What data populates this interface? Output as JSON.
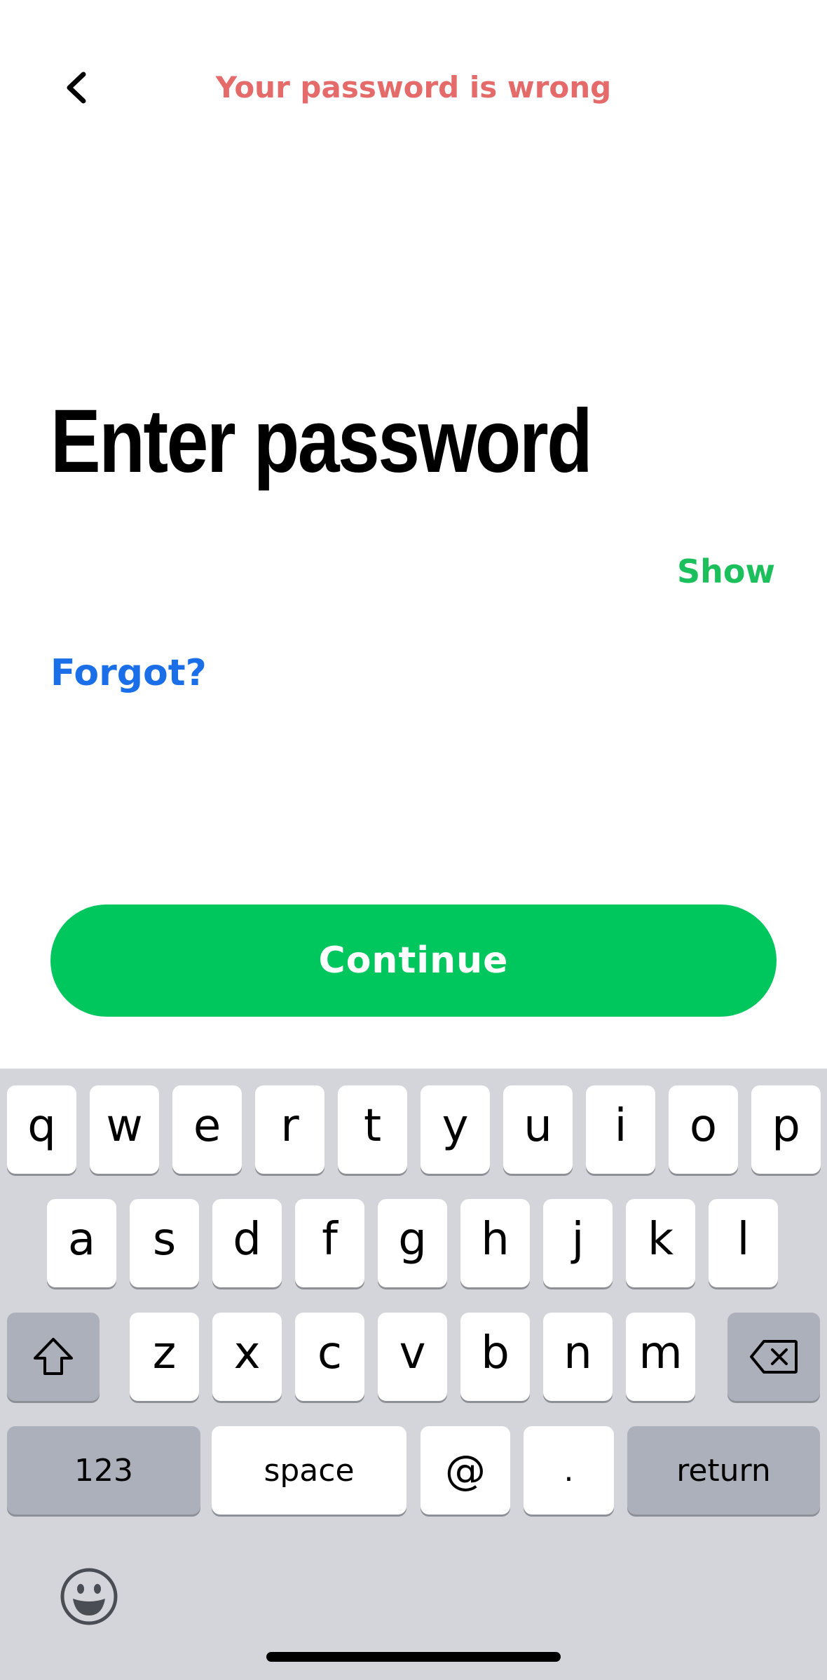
{
  "header": {
    "back_icon": "chevron-left-icon",
    "error_message": "Your password is wrong"
  },
  "main": {
    "title": "Enter password",
    "password_value": "",
    "show_label": "Show",
    "forgot_label": "Forgot?",
    "continue_label": "Continue"
  },
  "keyboard": {
    "row1": [
      "q",
      "w",
      "e",
      "r",
      "t",
      "y",
      "u",
      "i",
      "o",
      "p"
    ],
    "row2": [
      "a",
      "s",
      "d",
      "f",
      "g",
      "h",
      "j",
      "k",
      "l"
    ],
    "row3": [
      "z",
      "x",
      "c",
      "v",
      "b",
      "n",
      "m"
    ],
    "shift_icon": "shift-icon",
    "delete_icon": "backspace-icon",
    "numbers_label": "123",
    "space_label": "space",
    "at_label": "@",
    "dot_label": ".",
    "return_label": "return",
    "emoji_icon": "emoji-icon"
  },
  "colors": {
    "error": "#e56a6a",
    "accent_green": "#00c65e",
    "link_blue": "#1a6fe8",
    "keyboard_bg": "#d3d5db",
    "key_dark": "#acb0ba"
  }
}
